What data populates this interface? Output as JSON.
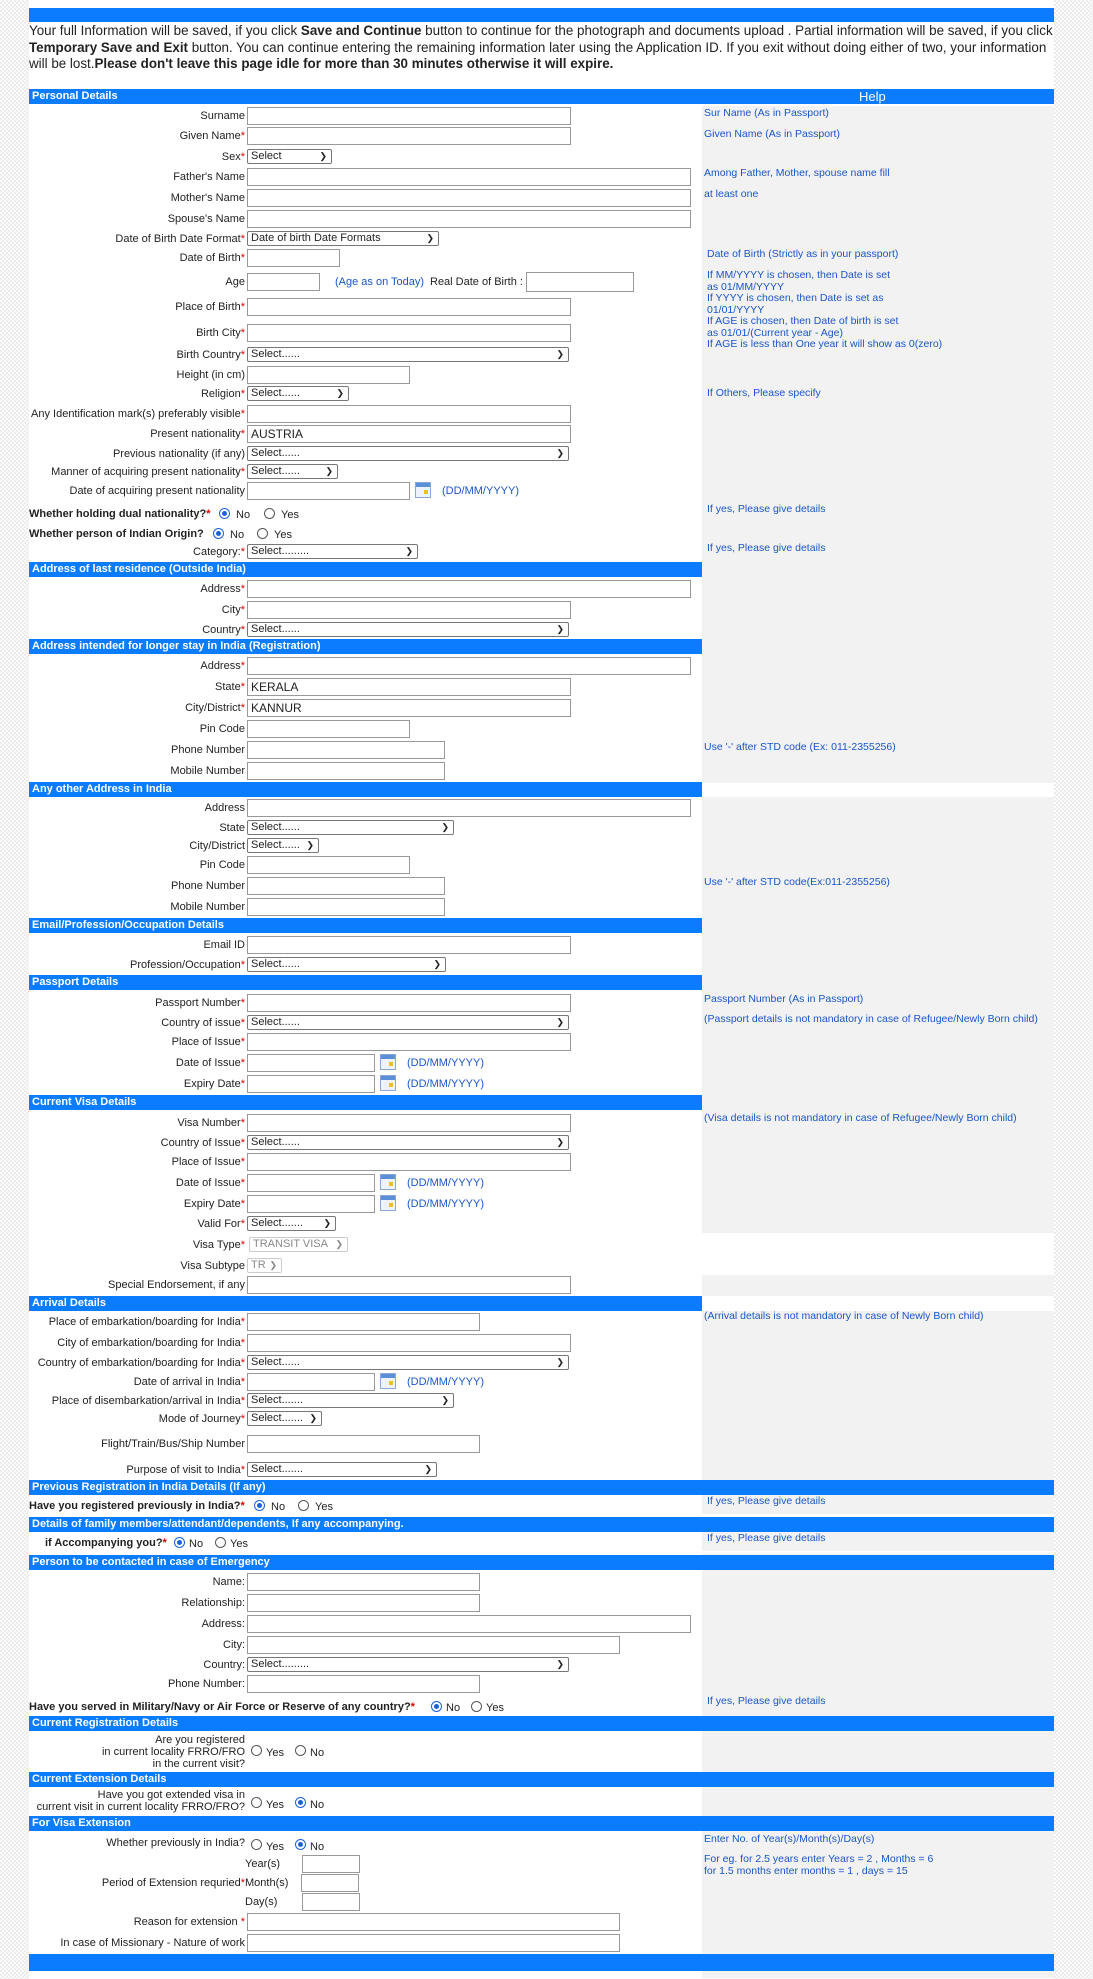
{
  "notice": {
    "p1": "Your full Information will be saved, if you click ",
    "b1": "Save and Continue",
    "p2": " button to continue for the photograph and documents upload . Partial information will be saved, if you click ",
    "b2": "Temporary Save and Exit",
    "p3": " button. You can continue entering the remaining information later using the Application ID. If you exit without doing either of two, your information will be lost.",
    "b3": "Please don't leave this page idle for more than 30 minutes otherwise it will expire."
  },
  "common": {
    "required": "*",
    "date_format": "(DD/MM/YYYY)",
    "no": "No",
    "yes": "Yes"
  },
  "sections": {
    "personal": "Personal Details",
    "help": "Help",
    "last_residence": "Address of last residence (Outside India)",
    "stay_address": "Address intended for longer stay in India (Registration)",
    "other_address": "Any other Address in India",
    "email": "Email/Profession/Occupation Details",
    "passport": "Passport Details",
    "visa": "Current Visa Details",
    "arrival": "Arrival Details",
    "prev_reg": "Previous Registration in India Details (If any)",
    "family": "Details of family members/attendant/dependents, If any accompanying.",
    "emergency": "Person to be contacted in case of Emergency",
    "current_reg": "Current Registration Details",
    "current_ext": "Current Extension Details",
    "visa_ext": "For Visa Extension"
  },
  "personal": {
    "surname": "Surname",
    "given_name": "Given Name",
    "sex": "Sex",
    "sex_value": "Select",
    "father": "Father's Name",
    "mother": "Mother's Name",
    "spouse": "Spouse's Name",
    "dob_format": "Date of Birth Date Format",
    "dob_format_value": "Date of birth Date Formats",
    "dob": "Date of Birth",
    "age": "Age",
    "age_hint": "(Age as on Today)",
    "real_dob": "Real Date of Birth :",
    "place_of_birth": "Place of Birth",
    "birth_city": "Birth City",
    "birth_country": "Birth Country",
    "birth_country_value": "Select......",
    "height": "Height (in cm)",
    "religion": "Religion",
    "religion_value": "Select......",
    "ident_mark": "Any Identification mark(s) preferably visible",
    "present_nat": "Present nationality",
    "present_nat_value": "AUSTRIA",
    "prev_nat": "Previous nationality (if any)",
    "prev_nat_value": "Select......",
    "manner_nat": "Manner of acquiring present nationality",
    "manner_nat_value": "Select......",
    "date_nat": "Date of acquiring present nationality",
    "dual_nat": "Whether holding dual nationality?",
    "indian_origin": "Whether person of Indian Origin?",
    "category": "Category:",
    "category_value": "Select........."
  },
  "last_residence": {
    "address": "Address",
    "city": "City",
    "country": "Country",
    "country_value": "Select......"
  },
  "stay_address": {
    "address": "Address",
    "state": "State",
    "state_value": "KERALA",
    "city": "City/District",
    "city_value": "KANNUR",
    "pin": "Pin Code",
    "phone": "Phone Number",
    "mobile": "Mobile Number"
  },
  "other_address": {
    "address": "Address",
    "state": "State",
    "state_value": "Select......",
    "city": "City/District",
    "city_value": "Select......",
    "pin": "Pin Code",
    "phone": "Phone Number",
    "mobile": "Mobile Number"
  },
  "email": {
    "email": "Email ID",
    "profession": "Profession/Occupation",
    "profession_value": "Select......"
  },
  "passport": {
    "number": "Passport Number",
    "country": "Country of issue",
    "country_value": "Select......",
    "place": "Place of Issue",
    "issue_date": "Date of Issue",
    "expiry": "Expiry Date"
  },
  "visa": {
    "number": "Visa Number",
    "country": "Country of Issue",
    "country_value": "Select......",
    "place": "Place of Issue",
    "issue_date": "Date of Issue",
    "expiry": "Expiry Date",
    "valid_for": "Valid For",
    "valid_for_value": "Select.......",
    "type": "Visa Type",
    "type_value": "TRANSIT VISA",
    "subtype": "Visa Subtype",
    "subtype_value": "TR",
    "endorsement": "Special Endorsement, if any"
  },
  "arrival": {
    "place": "Place of embarkation/boarding for India",
    "city": "City of embarkation/boarding for India",
    "country": "Country of embarkation/boarding for India",
    "country_value": "Select......",
    "date": "Date of arrival in India",
    "disembark": "Place of disembarkation/arrival in India",
    "disembark_value": "Select.......",
    "mode": "Mode of Journey",
    "mode_value": "Select.......",
    "flight": "Flight/Train/Bus/Ship Number",
    "purpose": "Purpose of visit to India",
    "purpose_value": "Select......."
  },
  "prev_reg": {
    "question": "Have you registered previously in India?"
  },
  "family": {
    "question": "if Accompanying you?"
  },
  "emergency": {
    "name": "Name:",
    "relationship": "Relationship:",
    "address": "Address:",
    "city": "City:",
    "country": "Country:",
    "country_value": "Select.........",
    "phone": "Phone Number:",
    "military": "Have you served in Military/Navy or Air Force or Reserve of any country?"
  },
  "current_reg": {
    "q1": "Are you registered",
    "q2": "in current locality FRRO/FRO",
    "q3": "in the current visit?"
  },
  "current_ext": {
    "q1": "Have you got extended visa in",
    "q2": "current visit in current locality FRRO/FRO?"
  },
  "visa_ext": {
    "prev_india": "Whether previously in India?",
    "period": "Period of Extension requried",
    "years": "Year(s)",
    "months": "Month(s)",
    "days": "Day(s)",
    "reason": "Reason for extension ",
    "missionary": "In case of Missionary - Nature of work"
  },
  "help": {
    "surname": "Sur Name (As in Passport)",
    "given": "Given Name (As in Passport)",
    "parents1": "Among Father, Mother, spouse name fill",
    "parents2": "at least one",
    "dob": "Date of Birth (Strictly as in your passport)",
    "mm1": "If MM/YYYY is chosen, then Date is set",
    "mm2": "as 01/MM/YYYY",
    "yy1": "If YYYY is chosen, then Date is set as",
    "yy2": "01/01/YYYY",
    "age1": "If AGE is chosen, then Date of birth is set",
    "age2": "as 01/01/(Current year - Age)",
    "age3": "If AGE is less than One year it will show as 0(zero)",
    "religion": "If Others, Please specify",
    "if_yes": "If yes, Please give details",
    "std1": "Use '-' after STD code (Ex: 011-2355256)",
    "std2": "Use '-' after STD code(Ex:011-2355256)",
    "passport_no": "Passport Number (As in Passport)",
    "passport_note": "(Passport details is not mandatory in case of Refugee/Newly Born child)",
    "visa_note": "(Visa details is not mandatory in case of Refugee/Newly Born child)",
    "arrival_note": "(Arrival details is not mandatory in case of Newly Born child)",
    "ext1": "Enter No. of Year(s)/Month(s)/Day(s)",
    "ext2": "For eg. for 2.5 years enter Years = 2 , Months = 6",
    "ext3": "for 1.5 months enter months = 1 , days = 15"
  }
}
